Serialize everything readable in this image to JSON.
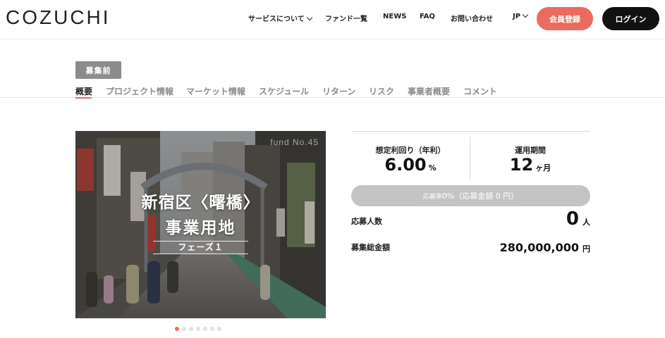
{
  "header": {
    "logo": "COZUCHI",
    "nav": {
      "services": "サービスについて",
      "funds": "ファンド一覧",
      "news": "NEWS",
      "faq": "FAQ",
      "contact": "お問い合わせ",
      "language": "JP"
    },
    "register_label": "会員登録",
    "login_label": "ログイン"
  },
  "status": "募集前",
  "tabs": [
    "概要",
    "プロジェクト情報",
    "マーケット情報",
    "スケジュール",
    "リターン",
    "リスク",
    "事業者概要",
    "コメント"
  ],
  "active_tab": 0,
  "hero": {
    "fund_no": "fund No.45",
    "title_line1": "新宿区〈曙橋〉",
    "title_line2": "事業用地",
    "phase": "フェーズ１"
  },
  "carousel": {
    "count": 7,
    "active": 0
  },
  "summary": {
    "yield_label": "想定利回り（年利）",
    "yield_value": "6.00",
    "yield_unit": "%",
    "term_label": "運用期間",
    "term_value": "12",
    "term_unit": "ヶ月",
    "progress_percent": 0,
    "progress_prefix": "応募率",
    "progress_text": "0%（応募金額 0 円）",
    "applicants_label": "応募人数",
    "applicants_value": "0",
    "applicants_unit": "人",
    "total_label": "募集総金額",
    "total_value": "280,000,000",
    "total_unit": "円"
  },
  "colors": {
    "accent": "#ea6b60",
    "dark": "#111111",
    "status_badge": "#8c8c8c",
    "progress_track": "#c4c4c4"
  },
  "icons": {
    "services_dropdown": "chevron-down-icon",
    "language_dropdown": "chevron-down-icon"
  }
}
